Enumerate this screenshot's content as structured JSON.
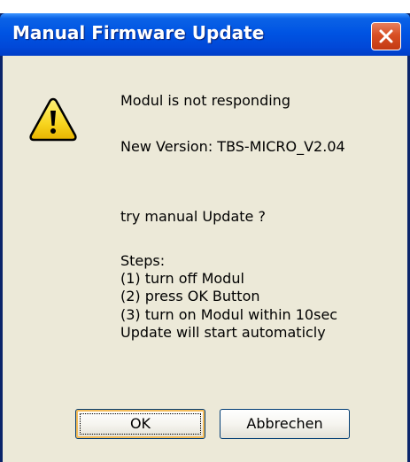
{
  "dialog": {
    "title": "Manual Firmware Update",
    "icon": "warning-icon",
    "messages": [
      "Modul is not responding",
      "New Version: TBS-MICRO_V2.04",
      "try manual Update ?",
      "Steps:",
      "(1) turn off Modul",
      "(2) press OK Button",
      "(3) turn on Modul within 10sec",
      "Update will start automaticly"
    ],
    "buttons": {
      "ok_label": "OK",
      "cancel_label": "Abbrechen"
    }
  },
  "colors": {
    "titlebar": "#0054e3",
    "client": "#ece9d8",
    "close": "#d84f24",
    "warning": "#f7d51f"
  }
}
